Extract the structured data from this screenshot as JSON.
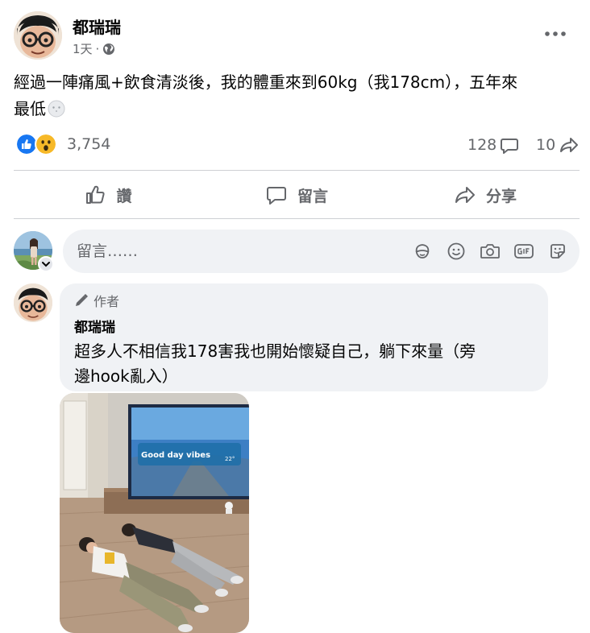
{
  "post": {
    "author_name": "都瑞瑞",
    "timestamp": "1天",
    "meta_separator": "·",
    "audience_icon": "globe-icon",
    "text_line1": "經過一陣痛風+飲食清淡後，我的體重來到60kg（我178cm），五年來",
    "text_line2": "最低",
    "emoji": "moon-face-icon"
  },
  "stats": {
    "reactions": [
      "like-icon",
      "wow-icon"
    ],
    "reaction_count": "3,754",
    "comment_count": "128",
    "share_count": "10"
  },
  "actions": {
    "like_label": "讚",
    "comment_label": "留言",
    "share_label": "分享"
  },
  "composer": {
    "placeholder": "留言……",
    "tools": [
      "avatar-sticker-icon",
      "emoji-icon",
      "camera-icon",
      "gif-icon",
      "sticker-icon"
    ]
  },
  "comment": {
    "badge_label": "作者",
    "author_name": "都瑞瑞",
    "text_line1": "超多人不相信我178害我也開始懷疑自己，躺下來量（旁",
    "text_line2": "邊hook亂入）"
  },
  "photo": {
    "tv_text": "Good day vibes",
    "tv_temp": "22°"
  },
  "colors": {
    "like_blue": "#1877f2",
    "wow_yellow": "#f7b928",
    "secondary_text": "#65676b",
    "bubble_bg": "#f0f2f5"
  }
}
